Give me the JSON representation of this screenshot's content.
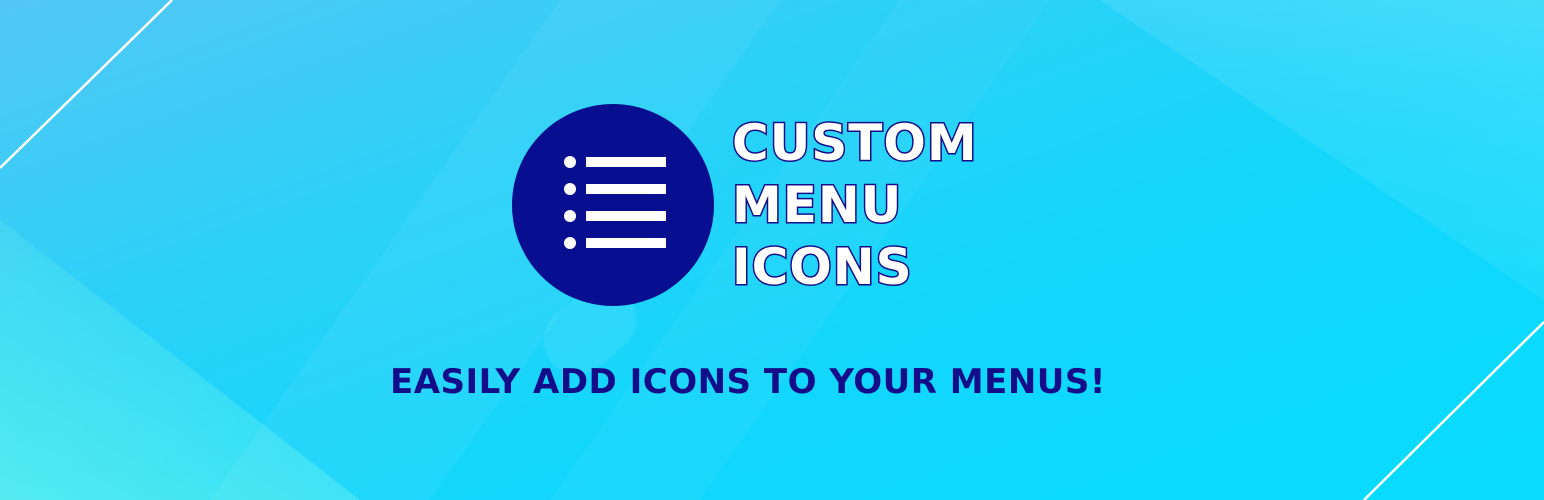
{
  "banner": {
    "title_lines": [
      "CUSTOM",
      "MENU",
      "ICONS"
    ],
    "tagline": "EASILY ADD ICONS TO YOUR MENUS!",
    "logo_icon": "list-icon"
  },
  "colors": {
    "accent_dark_blue": "#070e8f",
    "text_navy": "#140d8a",
    "background_cyan": "#14d6fb",
    "white": "#ffffff"
  }
}
